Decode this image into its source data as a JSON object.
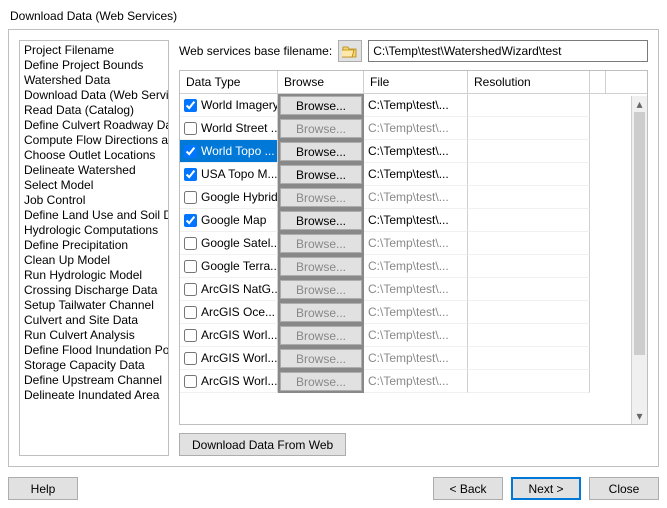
{
  "window_title": "Download Data (Web Services)",
  "nav": {
    "items": [
      "Project Filename",
      "Define Project Bounds",
      "Watershed Data",
      "Download Data (Web Services)",
      "Read Data (Catalog)",
      "Define Culvert Roadway Data",
      "Compute Flow Directions and",
      "Choose Outlet Locations",
      "Delineate Watershed",
      "Select Model",
      "Job Control",
      "Define Land Use and Soil Data",
      "Hydrologic Computations",
      "Define Precipitation",
      "Clean Up Model",
      "Run Hydrologic Model",
      "Crossing Discharge Data",
      "Setup Tailwater Channel",
      "Culvert and Site Data",
      "Run Culvert Analysis",
      "Define Flood Inundation Polygons",
      "Storage Capacity Data",
      "Define Upstream Channel",
      "Delineate Inundated Area"
    ]
  },
  "filename_label": "Web services base filename:",
  "filename_value": "C:\\Temp\\test\\WatershedWizard\\test",
  "headers": {
    "type": "Data Type",
    "browse": "Browse",
    "file": "File",
    "res": "Resolution"
  },
  "browse_label": "Browse...",
  "rows": [
    {
      "checked": true,
      "selected": false,
      "label": "World Imagery",
      "file": "C:\\Temp\\test\\...",
      "enabled": true
    },
    {
      "checked": false,
      "selected": false,
      "label": "World Street ...",
      "file": "C:\\Temp\\test\\...",
      "enabled": false
    },
    {
      "checked": true,
      "selected": true,
      "label": "World Topo ...",
      "file": "C:\\Temp\\test\\...",
      "enabled": true
    },
    {
      "checked": true,
      "selected": false,
      "label": "USA Topo M...",
      "file": "C:\\Temp\\test\\...",
      "enabled": true
    },
    {
      "checked": false,
      "selected": false,
      "label": "Google Hybrid",
      "file": "C:\\Temp\\test\\...",
      "enabled": false
    },
    {
      "checked": true,
      "selected": false,
      "label": "Google Map",
      "file": "C:\\Temp\\test\\...",
      "enabled": true
    },
    {
      "checked": false,
      "selected": false,
      "label": "Google Satel...",
      "file": "C:\\Temp\\test\\...",
      "enabled": false
    },
    {
      "checked": false,
      "selected": false,
      "label": "Google Terra...",
      "file": "C:\\Temp\\test\\...",
      "enabled": false
    },
    {
      "checked": false,
      "selected": false,
      "label": "ArcGIS NatG...",
      "file": "C:\\Temp\\test\\...",
      "enabled": false
    },
    {
      "checked": false,
      "selected": false,
      "label": "ArcGIS Oce...",
      "file": "C:\\Temp\\test\\...",
      "enabled": false
    },
    {
      "checked": false,
      "selected": false,
      "label": "ArcGIS Worl...",
      "file": "C:\\Temp\\test\\...",
      "enabled": false
    },
    {
      "checked": false,
      "selected": false,
      "label": "ArcGIS Worl...",
      "file": "C:\\Temp\\test\\...",
      "enabled": false
    },
    {
      "checked": false,
      "selected": false,
      "label": "ArcGIS Worl...",
      "file": "C:\\Temp\\test\\...",
      "enabled": false
    }
  ],
  "download_button": "Download Data From Web",
  "footer": {
    "help": "Help",
    "back": "< Back",
    "next": "Next >",
    "close": "Close"
  }
}
